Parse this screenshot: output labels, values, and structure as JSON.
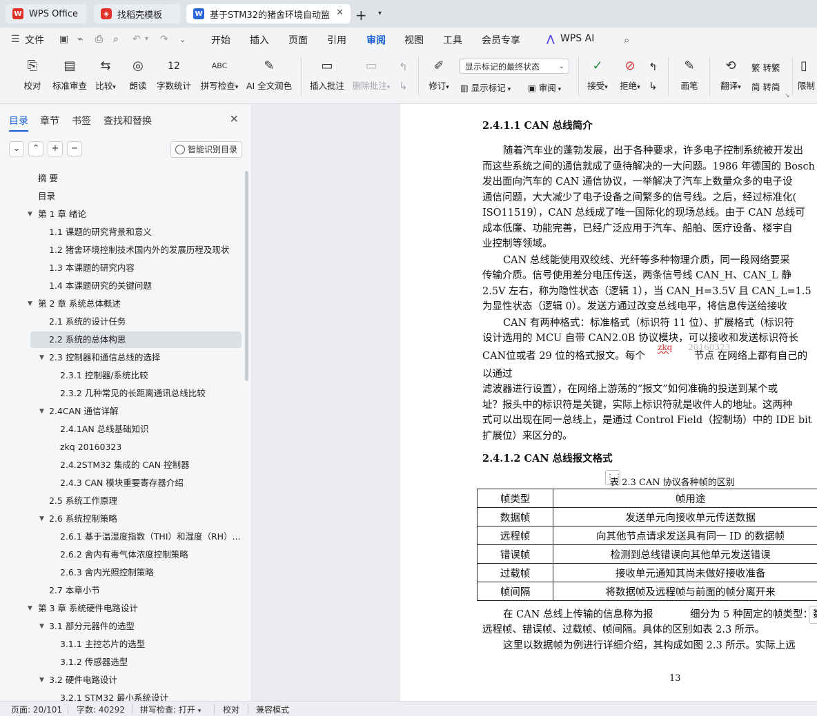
{
  "tabs": [
    {
      "label": "WPS Office",
      "icon": "wps-logo-icon"
    },
    {
      "label": "找稻壳模板",
      "icon": "docer-icon"
    },
    {
      "label": "基于STM32的猪舍环境自动监",
      "icon": "word-doc-icon",
      "active": true
    }
  ],
  "menubar": {
    "file_label": "文件",
    "items": [
      "开始",
      "插入",
      "页面",
      "引用",
      "审阅",
      "视图",
      "工具",
      "会员专享"
    ],
    "active": "审阅",
    "ai_label": "WPS AI"
  },
  "ribbon": {
    "proofread": "校对",
    "standard_review": "标准审查",
    "compare": "比较",
    "read_aloud": "朗读",
    "word_count": "字数统计",
    "spell_check": "拼写检查",
    "ai_polish": "AI 全文润色",
    "insert_comment": "插入批注",
    "delete_comment": "删除批注",
    "revise": "修订",
    "markup_dropdown": "显示标记的最终状态",
    "show_markup": "显示标记",
    "review": "审阅",
    "accept": "接受",
    "reject": "拒绝",
    "pen": "画笔",
    "translate": "翻译",
    "to_traditional": "转繁",
    "to_simplified": "转简",
    "restrict": "限制"
  },
  "nav": {
    "tabs": [
      "目录",
      "章节",
      "书签",
      "查找和替换"
    ],
    "active_tab": "目录",
    "smart_button": "智能识别目录",
    "items": [
      {
        "label": "摘 要",
        "level": 0,
        "arrow": false
      },
      {
        "label": "目录",
        "level": 0,
        "arrow": false
      },
      {
        "label": "第 1 章 绪论",
        "level": 0,
        "arrow": true
      },
      {
        "label": "1.1  课题的研究背景和意义",
        "level": 1,
        "arrow": false
      },
      {
        "label": "1.2  猪舍环境控制技术国内外的发展历程及现状",
        "level": 1,
        "arrow": false
      },
      {
        "label": "1.3  本课题的研究内容",
        "level": 1,
        "arrow": false
      },
      {
        "label": "1.4  本课题研究的关键问题",
        "level": 1,
        "arrow": false
      },
      {
        "label": "第 2 章 系统总体概述",
        "level": 0,
        "arrow": true
      },
      {
        "label": "2.1  系统的设计任务",
        "level": 1,
        "arrow": false
      },
      {
        "label": "2.2  系统的总体构思",
        "level": 1,
        "arrow": false,
        "selected": true
      },
      {
        "label": "2.3  控制器和通信总线的选择",
        "level": 1,
        "arrow": true
      },
      {
        "label": "2.3.1 控制器/系统比较",
        "level": 2,
        "arrow": false
      },
      {
        "label": "2.3.2 几种常见的长距离通讯总线比较",
        "level": 2,
        "arrow": false
      },
      {
        "label": "2.4CAN 通信详解",
        "level": 1,
        "arrow": true
      },
      {
        "label": "2.4.1AN 总线基础知识",
        "level": 2,
        "arrow": false
      },
      {
        "label": "zkq  20160323",
        "level": 2,
        "arrow": false
      },
      {
        "label": "2.4.2STM32 集成的 CAN 控制器",
        "level": 2,
        "arrow": false
      },
      {
        "label": "2.4.3 CAN 模块重要寄存器介绍",
        "level": 2,
        "arrow": false
      },
      {
        "label": "2.5  系统工作原理",
        "level": 1,
        "arrow": false
      },
      {
        "label": "2.6  系统控制策略",
        "level": 1,
        "arrow": true
      },
      {
        "label": "2.6.1 基于温湿度指数（THI）和湿度（RH）...",
        "level": 2,
        "arrow": false
      },
      {
        "label": "2.6.2 舍内有毒气体浓度控制策略",
        "level": 2,
        "arrow": false
      },
      {
        "label": "2.6.3 舍内光照控制策略",
        "level": 2,
        "arrow": false
      },
      {
        "label": "2.7  本章小节",
        "level": 1,
        "arrow": false
      },
      {
        "label": "第 3 章 系统硬件电路设计",
        "level": 0,
        "arrow": true
      },
      {
        "label": "3.1  部分元器件的选型",
        "level": 1,
        "arrow": true
      },
      {
        "label": "3.1.1 主控芯片的选型",
        "level": 2,
        "arrow": false
      },
      {
        "label": "3.1.2 传感器选型",
        "level": 2,
        "arrow": false
      },
      {
        "label": "3.2  硬件电路设计",
        "level": 1,
        "arrow": true
      },
      {
        "label": "3.2.1 STM32 最小系统设计",
        "level": 2,
        "arrow": false
      }
    ]
  },
  "doc": {
    "lines": [
      {
        "t": "2.4.1.1 CAN 总线简介",
        "cls": "heading",
        "x": 0
      },
      {
        "t": "随着汽车业的蓬勃发展，出于各种要求，许多电子控制系统被开发出",
        "x": 30
      },
      {
        "t": "而这些系统之间的通信就成了亟待解决的一大问题。1986 年德国的 Bosch",
        "x": 0
      },
      {
        "t": "发出面向汽车的 CAN 通信协议，一举解决了汽车上数量众多的电子设",
        "x": 0
      },
      {
        "t": "通信问题，大大减少了电子设备之间繁多的信号线。之后，经过标准化(",
        "x": 0
      },
      {
        "t": "ISO11519），CAN 总线成了唯一国际化的现场总线。由于 CAN 总线可",
        "x": 0
      },
      {
        "t": "成本低廉、功能完善，已经广泛应用于汽车、船舶、医疗设备、楼宇自",
        "x": 0
      },
      {
        "t": "业控制等领域。",
        "x": 0
      },
      {
        "t": "CAN 总线能使用双绞线、光纤等多种物理介质，同一段网络要采",
        "x": 30
      },
      {
        "t": "传输介质。信号使用差分电压传送，两条信号线 CAN_H、CAN_L 静",
        "x": 0
      },
      {
        "t": "2.5V 左右，称为隐性状态（逻辑 1），当 CAN_H=3.5V 且 CAN_L=1.5",
        "x": 0
      },
      {
        "t": "为显性状态（逻辑 0）。发送方通过改变总线电平，将信息传送给接收",
        "x": 0
      },
      {
        "t": "CAN 有两种格式：标准格式（标识符 11 位）、扩展格式（标识符",
        "x": 30
      },
      {
        "t": "设计选用的 MCU 自带 CAN2.0B 协议模块，可以接收和发送标识符长",
        "x": 0
      },
      {
        "t": "CAN位或者 29 位的格式报文。每个",
        "x": 0
      },
      {
        "t": "以通过",
        "x": 0
      },
      {
        "t": "滤波器进行设置），在网络上游荡的“报文”如何准确的投送到某个或",
        "x": 0
      },
      {
        "t": "址？报头中的标识符是关键，实际上标识符就是收件人的地址。这两种",
        "x": 0
      },
      {
        "t": "式可以出现在同一总线上，是通过 Control Field（控制场）中的 IDE bit",
        "x": 0
      },
      {
        "t": "扩展位）来区分的。",
        "x": 0
      },
      {
        "t": "2.4.1.2 CAN 总线报文格式",
        "cls": "heading",
        "x": 0
      }
    ],
    "inline_ghost": "zkq",
    "inline_ghost2": "20160323",
    "inline_tail": "节点 在网络上都有自己的",
    "table_caption": "表 2.3 CAN 协议各种帧的区别",
    "table_header": [
      "帧类型",
      "帧用途"
    ],
    "table_rows": [
      [
        "数据帧",
        "发送单元向接收单元传送数据"
      ],
      [
        "远程帧",
        "向其他节点请求发送具有同一 ID 的数据帧"
      ],
      [
        "错误帧",
        "检测到总线错误向其他单元发送错误"
      ],
      [
        "过载帧",
        "接收单元通知其尚未做好接收准备"
      ],
      [
        "帧间隔",
        "将数据帧及远程帧与前面的帧分离开来"
      ]
    ],
    "after_lines": [
      {
        "t": "在 CAN 总线上传输的信息称为报",
        "tail": "细分为 5 种固定的帧类型：数",
        "x": 30
      },
      {
        "t": "远程帧、错误帧、过载帧、帧间隔。具体的区别如表 2.3 所示。",
        "x": 0
      },
      {
        "t": "这里以数据帧为例进行详细介绍，其构成如图 2.3 所示。实际上远",
        "x": 30
      }
    ],
    "page_number": "13"
  },
  "status": {
    "page": "页面: 20/101",
    "words": "字数: 40292",
    "spell": "拼写检查: 打开",
    "proof": "校对",
    "compat": "兼容模式"
  }
}
